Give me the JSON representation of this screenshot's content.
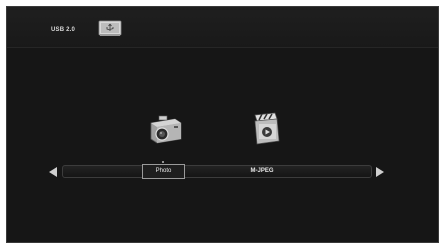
{
  "status_bar": {
    "usb_label": "USB 2.0",
    "usb_icon": "usb-drive-icon"
  },
  "media_icons": [
    {
      "icon": "camera-icon"
    },
    {
      "icon": "video-clapper-icon"
    }
  ],
  "selector": {
    "items": [
      {
        "label": "Photo",
        "selected": true
      },
      {
        "label": "M-JPEG",
        "selected": false
      }
    ],
    "left_arrow_icon": "triangle-left-icon",
    "right_arrow_icon": "triangle-right-icon"
  },
  "colors": {
    "screen_background": "#161616",
    "text": "#e6e6e6",
    "selection_border": "#9a9a9a"
  }
}
